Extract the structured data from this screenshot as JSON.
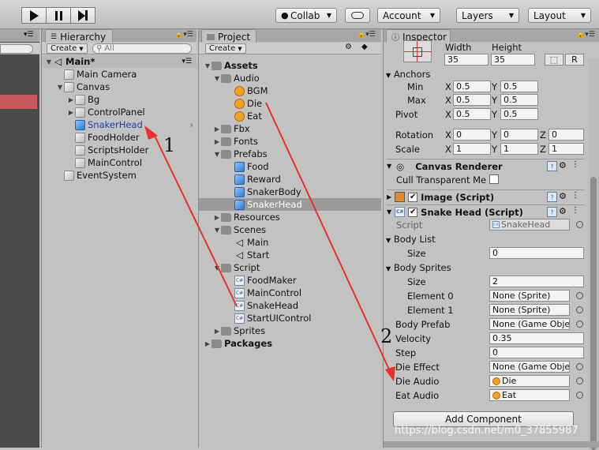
{
  "toolbar": {
    "collab_label": "Collab",
    "account_label": "Account",
    "layers_label": "Layers",
    "layout_label": "Layout"
  },
  "hierarchy": {
    "tab_label": "Hierarchy",
    "create_label": "Create",
    "search_placeholder": "All",
    "scene_name": "Main*",
    "items": [
      "Main Camera",
      "Canvas",
      "Bg",
      "ControlPanel",
      "SnakerHead",
      "FoodHolder",
      "ScriptsHolder",
      "MainControl",
      "EventSystem"
    ]
  },
  "project": {
    "tab_label": "Project",
    "create_label": "Create",
    "items": [
      "Assets",
      "Audio",
      "BGM",
      "Die",
      "Eat",
      "Fbx",
      "Fonts",
      "Prefabs",
      "Food",
      "Reward",
      "SnakerBody",
      "SnakerHead",
      "Resources",
      "Scenes",
      "Main",
      "Start",
      "Script",
      "FoodMaker",
      "MainControl",
      "SnakeHead",
      "StartUIControl",
      "Sprites",
      "Packages"
    ]
  },
  "inspector": {
    "tab_label": "Inspector",
    "width_label": "Width",
    "height_label": "Height",
    "width_value": "35",
    "height_value": "35",
    "r_button": "R",
    "anchors_label": "Anchors",
    "min_label": "Min",
    "max_label": "Max",
    "pivot_label": "Pivot",
    "x": "X",
    "y": "Y",
    "z": "Z",
    "anchor_min_x": "0.5",
    "anchor_min_y": "0.5",
    "anchor_max_x": "0.5",
    "anchor_max_y": "0.5",
    "pivot_x": "0.5",
    "pivot_y": "0.5",
    "rotation_label": "Rotation",
    "rot_x": "0",
    "rot_y": "0",
    "rot_z": "0",
    "scale_label": "Scale",
    "scale_x": "1",
    "scale_y": "1",
    "scale_z": "1",
    "canvas_renderer": "Canvas Renderer",
    "cull_label": "Cull Transparent Me",
    "image_script": "Image (Script)",
    "snakehead_script": "Snake Head (Script)",
    "script_label": "Script",
    "script_value": "SnakeHead",
    "body_list": "Body List",
    "size_label": "Size",
    "body_list_size": "0",
    "body_sprites": "Body Sprites",
    "body_sprites_size": "2",
    "element0": "Element 0",
    "element0_value": "None (Sprite)",
    "element1": "Element 1",
    "element1_value": "None (Sprite)",
    "body_prefab": "Body Prefab",
    "body_prefab_value": "None (Game Obje",
    "velocity": "Velocity",
    "velocity_value": "0.35",
    "step": "Step",
    "step_value": "0",
    "die_effect": "Die Effect",
    "die_effect_value": "None (Game Obje",
    "die_audio": "Die Audio",
    "die_audio_value": "Die",
    "eat_audio": "Eat Audio",
    "eat_audio_value": "Eat",
    "add_component": "Add Component"
  },
  "annotations": {
    "label1": "1",
    "label2": "2",
    "watermark": "https://blog.csdn.net/m0_37855987"
  },
  "colors": {
    "arrow": "#e8302a",
    "selected_text": "#1d3fa0"
  }
}
